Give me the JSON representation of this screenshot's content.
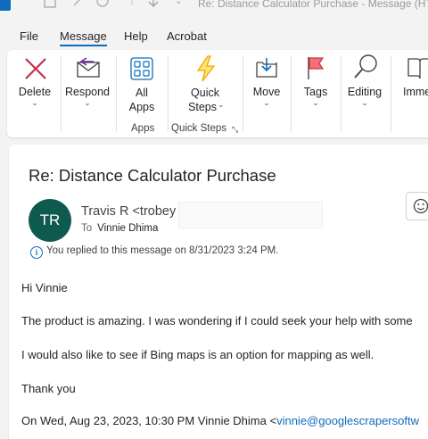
{
  "window": {
    "title": "Re: Distance Calculator Purchase  -  Message (HT"
  },
  "menu": {
    "tabs": [
      "File",
      "Message",
      "Help",
      "Acrobat"
    ],
    "active": "Message"
  },
  "ribbon": {
    "delete": "Delete",
    "respond": "Respond",
    "all_apps_line1": "All",
    "all_apps_line2": "Apps",
    "apps_group": "Apps",
    "quick_steps_line1": "Quick",
    "quick_steps_line2": "Steps",
    "quick_steps_group": "Quick Steps",
    "move": "Move",
    "tags": "Tags",
    "editing": "Editing",
    "immersive": "Immer"
  },
  "message": {
    "subject": "Re: Distance Calculator Purchase",
    "avatar_initials": "TR",
    "sender": "Travis R <trobey",
    "to_label": "To",
    "to_name": "Vinnie Dhima",
    "info": "You replied to this message on 8/31/2023 3:24 PM.",
    "greeting": "Hi Vinnie",
    "para1": "The product is amazing. I was wondering if I could seek your help with some",
    "para2": "I would also like to see if Bing maps is an option for mapping as well.",
    "thanks": "Thank you",
    "quote_prefix": "On Wed, Aug 23, 2023, 10:30 PM Vinnie Dhima <",
    "quote_link": "vinnie@googlescrapersoftw"
  },
  "colors": {
    "accent": "#0f6cbd",
    "avatar": "#0f5a4f",
    "delete_x": "#c4314b",
    "quick_steps": "#f7a800",
    "tags_flag": "#d13438"
  }
}
